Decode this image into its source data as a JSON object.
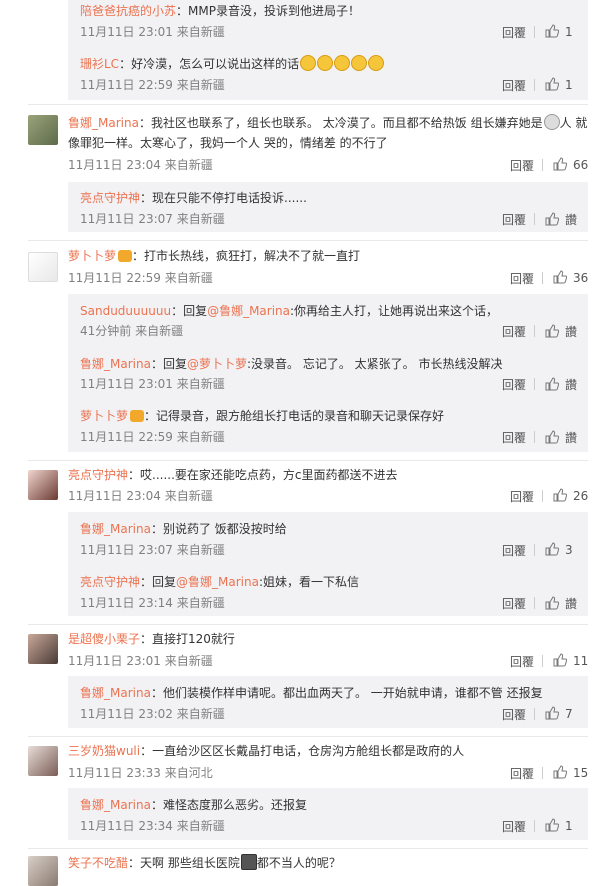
{
  "labels": {
    "reply": "回覆",
    "like": "讚"
  },
  "blocks": [
    {
      "id": "r0a",
      "name": "陪爸爸抗癌的小苏",
      "sep": "：",
      "text": "MMP录音没，投诉到他进局子！",
      "time": "11月11日 23:01",
      "source": "来自新疆",
      "likes": "1"
    },
    {
      "id": "r0b",
      "name": "珊衫LC",
      "sep": "：",
      "text": "好冷漠，怎么可以说出这样的话",
      "time": "11月11日 22:59",
      "source": "来自新疆",
      "likes": "1"
    },
    {
      "id": "c1",
      "name": "鲁娜_Marina",
      "sep": "：",
      "text1": "我社区也联系了，组长也联系。 太冷漠了。而且都不给热饭 组长嫌弃她是",
      "text1b": "人 就",
      "text2": "像罪犯一样。太寒心了，我妈一个人 哭的，情绪差 的不行了",
      "time": "11月11日 23:04",
      "source": "来自新疆",
      "likes": "66"
    },
    {
      "id": "r1a",
      "name": "亮点守护神",
      "sep": "：",
      "text": "现在只能不停打电话投诉......",
      "time": "11月11日 23:07",
      "source": "来自新疆",
      "likes": "讚"
    },
    {
      "id": "c2",
      "name": "萝卜卜萝",
      "sep": "：",
      "text": "打市长热线，疯狂打，解决不了就一直打",
      "time": "11月11日 22:59",
      "source": "来自新疆",
      "likes": "36"
    },
    {
      "id": "r2a",
      "name": "Sanduduuuuuu",
      "sep": "：回复",
      "mention": "@鲁娜_Marina",
      "text": ":你再给主人打，让她再说出来这个话，",
      "time": "41分钟前",
      "source": "来自新疆",
      "likes": "讚"
    },
    {
      "id": "r2b",
      "name": "鲁娜_Marina",
      "sep": "：回复",
      "mention": "@萝卜卜萝",
      "text": ":没录音。 忘记了。 太紧张了。 市长热线没解决",
      "time": "11月11日 23:01",
      "source": "来自新疆",
      "likes": "讚"
    },
    {
      "id": "r2c",
      "name": "萝卜卜萝",
      "sep": "：",
      "text": "记得录音，跟方舱组长打电话的录音和聊天记录保存好",
      "time": "11月11日 22:59",
      "source": "来自新疆",
      "likes": "讚"
    },
    {
      "id": "c3",
      "name": "亮点守护神",
      "sep": "：",
      "text": "哎......要在家还能吃点药，方c里面药都送不进去",
      "time": "11月11日 23:04",
      "source": "来自新疆",
      "likes": "26"
    },
    {
      "id": "r3a",
      "name": "鲁娜_Marina",
      "sep": "：",
      "text": "别说药了 饭都没按时给",
      "time": "11月11日 23:07",
      "source": "来自新疆",
      "likes": "3"
    },
    {
      "id": "r3b",
      "name": "亮点守护神",
      "sep": "：回复",
      "mention": "@鲁娜_Marina",
      "text": ":姐妹，看一下私信",
      "time": "11月11日 23:14",
      "source": "来自新疆",
      "likes": "讚"
    },
    {
      "id": "c4",
      "name": "是超傻小栗子",
      "sep": "：",
      "text": "直接打120就行",
      "time": "11月11日 23:01",
      "source": "来自新疆",
      "likes": "11"
    },
    {
      "id": "r4a",
      "name": "鲁娜_Marina",
      "sep": "：",
      "text": "他们装模作样申请呢。都出血两天了。 一开始就申请，谁都不管 还报复",
      "time": "11月11日 23:02",
      "source": "来自新疆",
      "likes": "7"
    },
    {
      "id": "c5",
      "name": "三岁奶猫wuli",
      "sep": "：",
      "text": "一直给沙区区长戴晶打电话，仓房沟方舱组长都是政府的人",
      "time": "11月11日 23:33",
      "source": "来自河北",
      "likes": "15"
    },
    {
      "id": "r5a",
      "name": "鲁娜_Marina",
      "sep": "：",
      "text": "难怪态度那么恶劣。还报复",
      "time": "11月11日 23:34",
      "source": "来自新疆",
      "likes": "1"
    },
    {
      "id": "c6",
      "name": "笑子不吃醋",
      "sep": "：",
      "text": "天啊 那些组长医院",
      "text2": "都不当人的呢？"
    }
  ]
}
